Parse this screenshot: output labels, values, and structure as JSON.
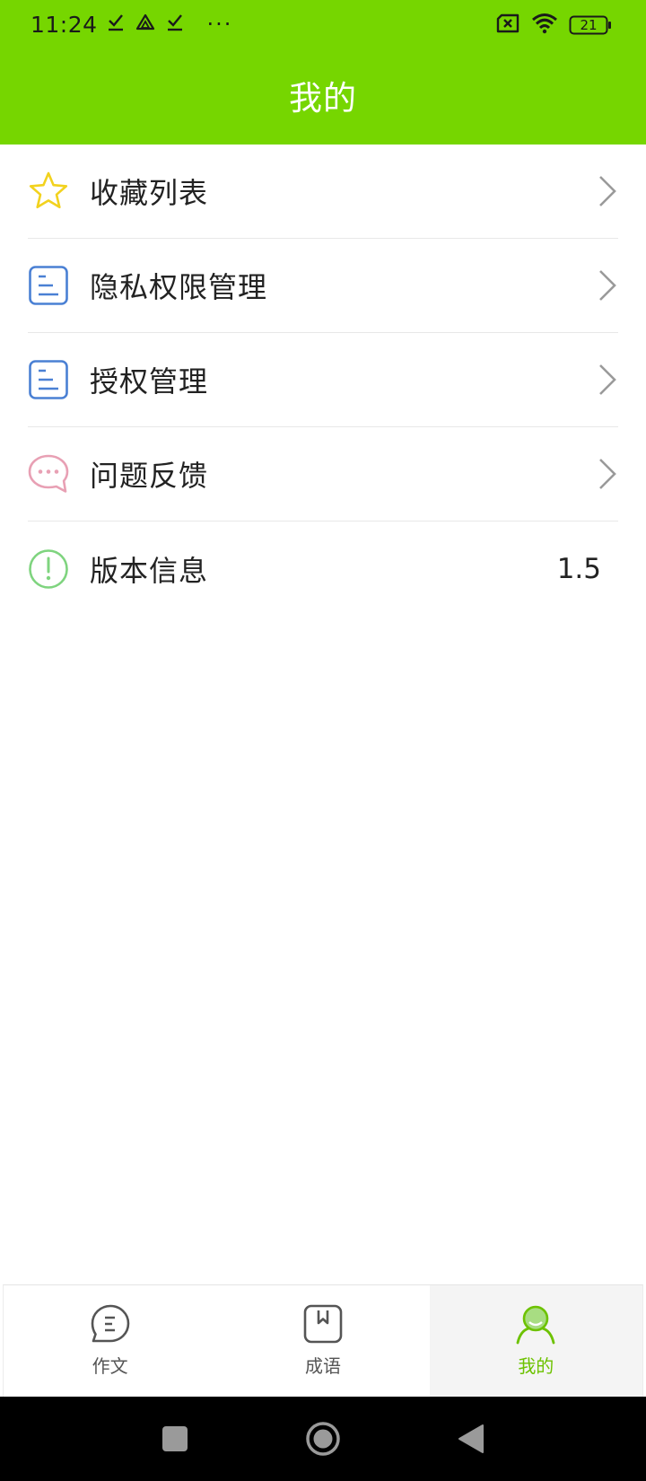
{
  "status_bar": {
    "time": "11:24",
    "left_icons": [
      "download-done-icon",
      "drive-icon",
      "download-done-icon",
      "more-dots-icon"
    ],
    "more_dots": "···",
    "right_icons": [
      "no-sim-icon",
      "wifi-icon",
      "battery-icon"
    ],
    "battery_level": "21"
  },
  "app_bar": {
    "title": "我的"
  },
  "menu": {
    "items": [
      {
        "label": "收藏列表",
        "icon": "star-icon"
      },
      {
        "label": "隐私权限管理",
        "icon": "document-icon"
      },
      {
        "label": "授权管理",
        "icon": "document-icon"
      },
      {
        "label": "问题反馈",
        "icon": "chat-bubble-icon"
      },
      {
        "label": "版本信息",
        "icon": "info-icon",
        "value": "1.5"
      }
    ]
  },
  "tab_bar": {
    "tabs": [
      {
        "label": "作文",
        "icon": "essay-bubble-icon",
        "active": false
      },
      {
        "label": "成语",
        "icon": "idiom-book-icon",
        "active": false
      },
      {
        "label": "我的",
        "icon": "profile-icon",
        "active": true
      }
    ]
  },
  "colors": {
    "brand_green": "#76d600",
    "active_tab_text": "#6dc200",
    "star_yellow": "#f2d21e",
    "doc_blue": "#4a80d4",
    "chat_pink": "#e8a0b4",
    "info_green": "#7fd47f"
  },
  "nav_bar": {
    "buttons": [
      "recents-square-icon",
      "home-circle-icon",
      "back-triangle-icon"
    ]
  }
}
